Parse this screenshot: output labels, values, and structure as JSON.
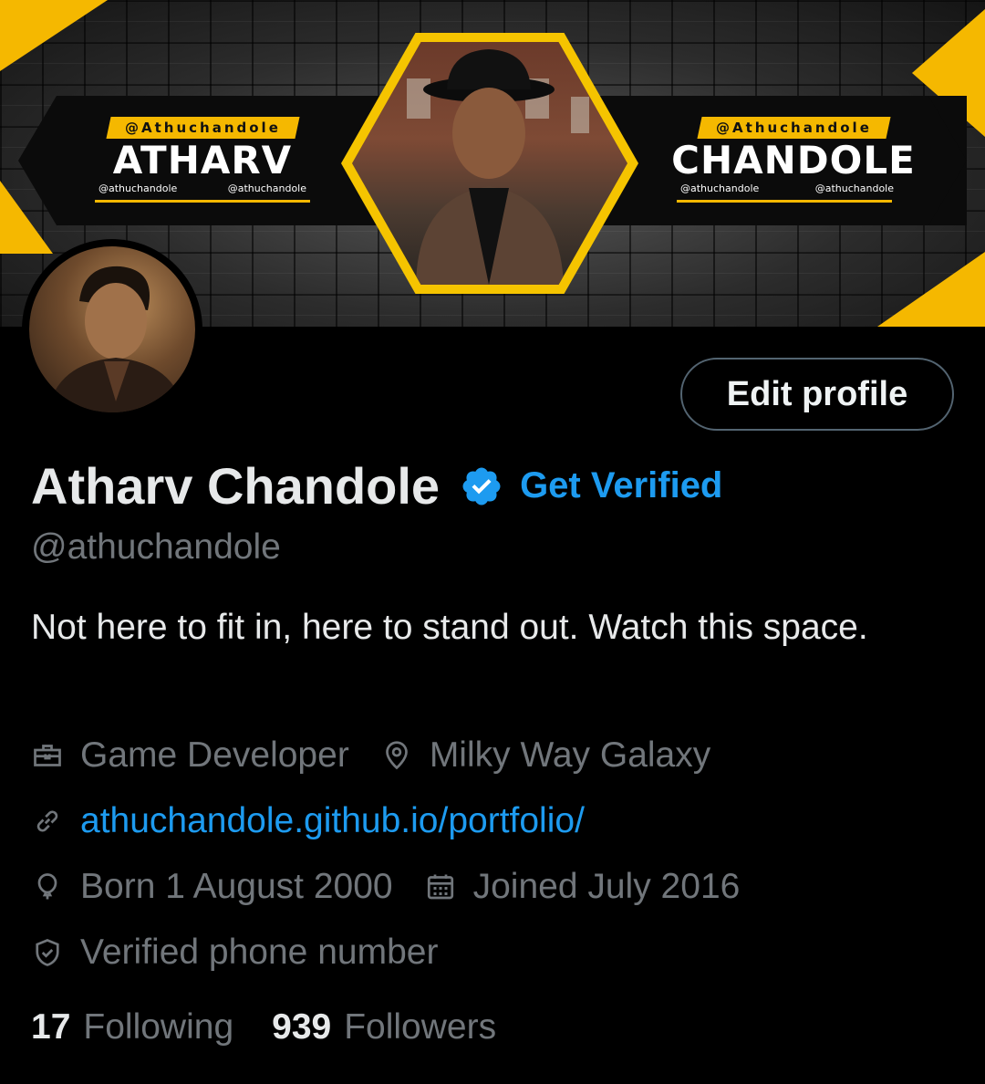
{
  "banner": {
    "left_tag": "@Athuchandole",
    "left_name": "ATHARV",
    "left_small_1": "@athuchandole",
    "left_small_2": "@athuchandole",
    "right_tag": "@Athuchandole",
    "right_name": "CHANDOLE",
    "right_small_1": "@athuchandole",
    "right_small_2": "@athuchandole",
    "accent_color": "#f5b800"
  },
  "profile": {
    "edit_button_label": "Edit profile",
    "display_name": "Atharv Chandole",
    "verified_badge_icon": "verified-badge-icon",
    "get_verified_label": "Get Verified",
    "handle": "@athuchandole",
    "bio": "Not here to fit in, here to stand out. Watch this space."
  },
  "meta": {
    "profession": "Game Developer",
    "location": "Milky Way Galaxy",
    "website": "athuchandole.github.io/portfolio/",
    "birthday": "Born 1 August 2000",
    "joined": "Joined July 2016",
    "verified_phone": "Verified phone number"
  },
  "stats": {
    "following_count": "17",
    "following_label": "Following",
    "followers_count": "939",
    "followers_label": "Followers"
  },
  "colors": {
    "background": "#000000",
    "primary_text": "#e7e9ea",
    "secondary_text": "#71767b",
    "link_blue": "#1d9bf0",
    "button_border": "#536471"
  }
}
